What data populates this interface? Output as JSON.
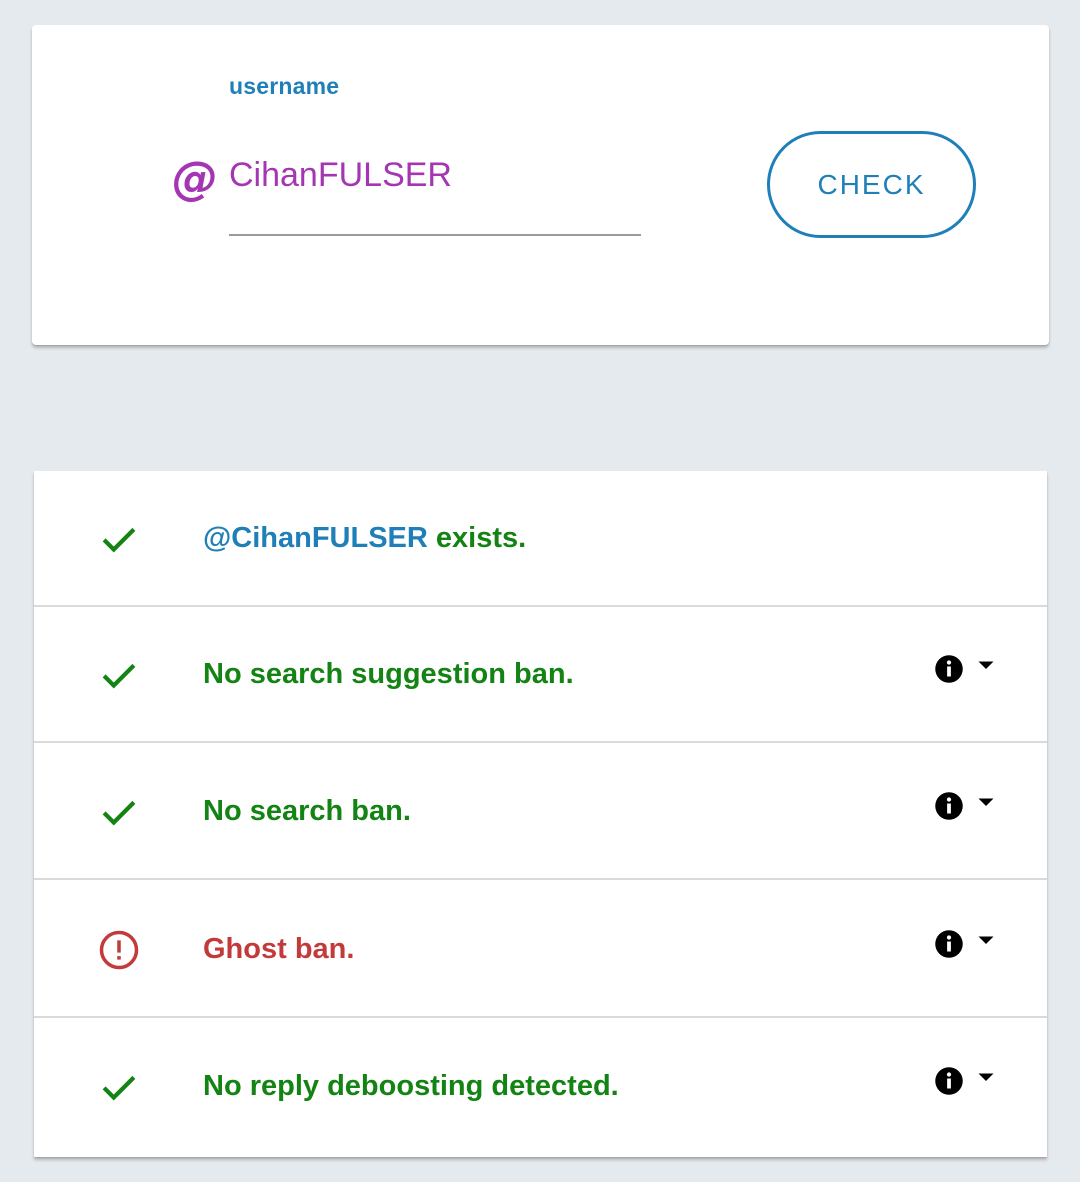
{
  "search": {
    "label": "username",
    "value": "CihanFULSER",
    "at_symbol": "@",
    "button_label": "CHECK"
  },
  "results": [
    {
      "status": "ok",
      "handle": "@CihanFULSER",
      "text": " exists.",
      "has_info": false
    },
    {
      "status": "ok",
      "text": "No search suggestion ban.",
      "has_info": true
    },
    {
      "status": "ok",
      "text": "No search ban.",
      "has_info": true
    },
    {
      "status": "bad",
      "text": "Ghost ban.",
      "has_info": true
    },
    {
      "status": "ok",
      "text": "No reply deboosting detected.",
      "has_info": true
    }
  ],
  "colors": {
    "accent": "#1f7fb8",
    "username": "#a436b3",
    "ok": "#138313",
    "bad": "#c23a3a",
    "background": "#e5eaef"
  },
  "icons": {
    "ok": "check-icon",
    "bad": "alert-circle-icon",
    "info": "info-icon",
    "toggle": "caret-down-icon"
  }
}
